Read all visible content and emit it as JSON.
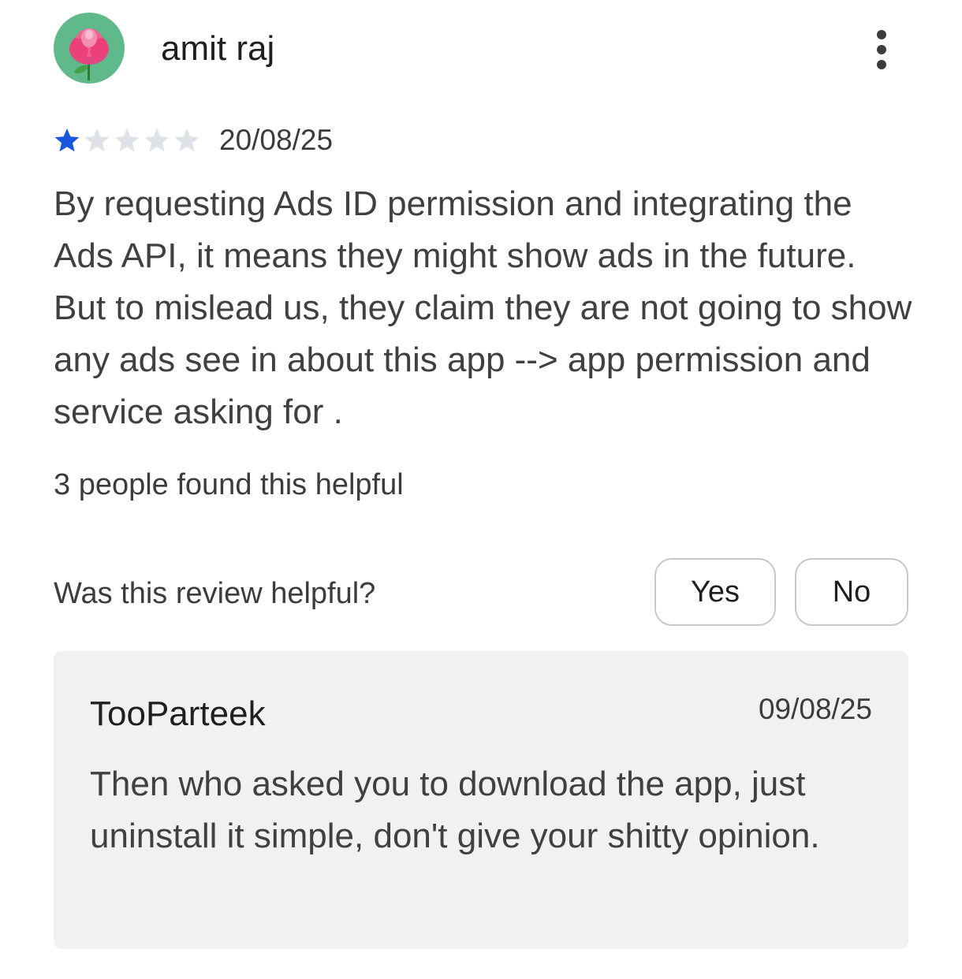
{
  "review": {
    "author": "amit raj",
    "rating": 1,
    "rating_max": 5,
    "date": "20/08/25",
    "text": "By requesting Ads ID permission and integrating the Ads API, it means they might show ads in the future. But to mislead us, they claim they are not going to show any ads see in about this app --> app permission and service asking for .",
    "helpful_count_text": "3 people found this helpful"
  },
  "feedback": {
    "question": "Was this review helpful?",
    "yes_label": "Yes",
    "no_label": "No"
  },
  "reply": {
    "author": "TooParteek",
    "date": "09/08/25",
    "text": "Then who asked you to download the app, just uninstall it simple, don't give your shitty opinion."
  },
  "icons": {
    "avatar": "lotus-flower-icon",
    "more": "more-vert-icon",
    "star_filled": "star-filled-icon",
    "star_empty": "star-empty-icon"
  },
  "colors": {
    "star_filled": "#1a56db",
    "star_empty": "#dfe3e8",
    "avatar_bg": "#5fb98a",
    "reply_bg": "#f1f1f1",
    "button_border": "#c8c8c8"
  }
}
